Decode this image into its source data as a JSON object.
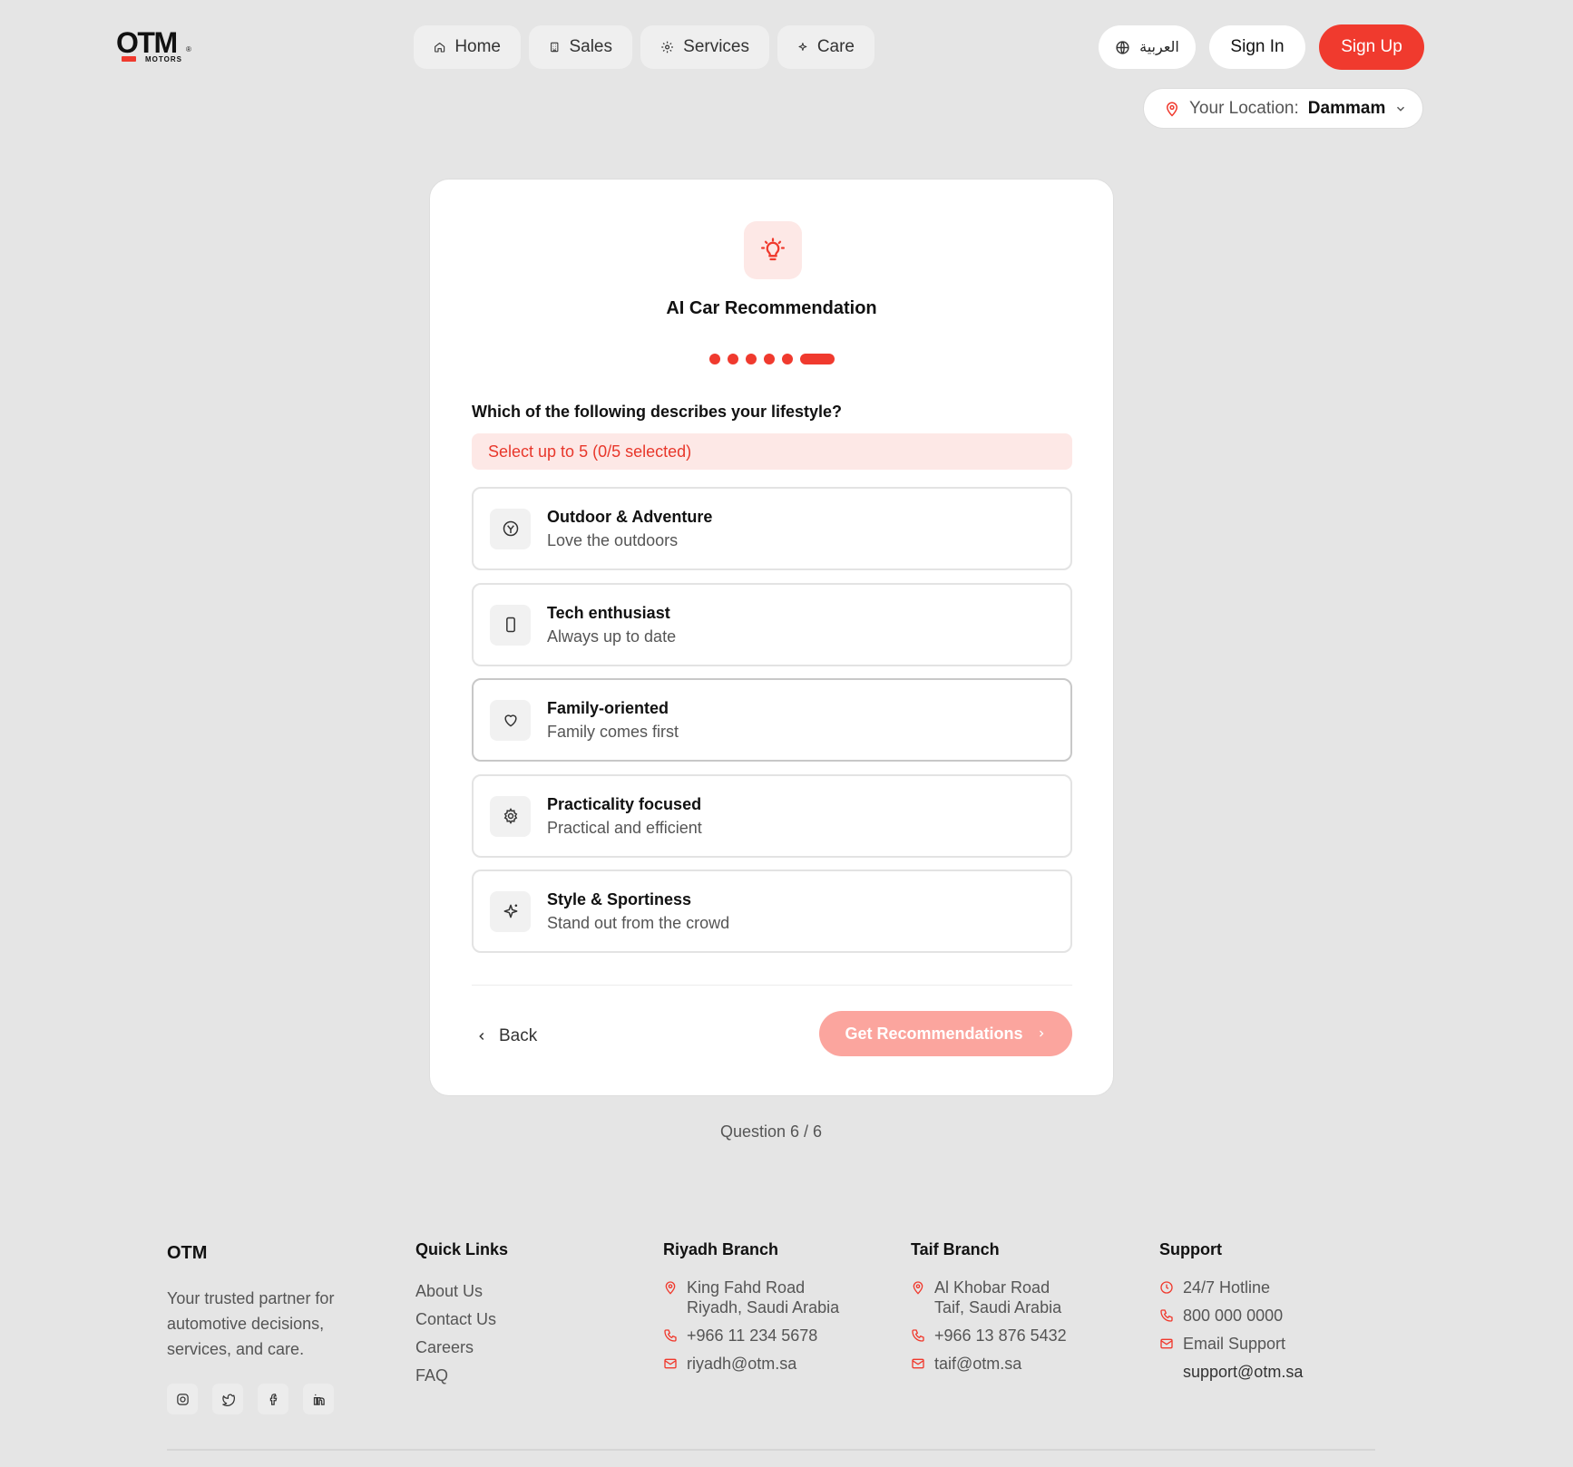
{
  "brand": {
    "name": "OTM",
    "sub": "MOTORS",
    "reg": "®"
  },
  "nav": [
    {
      "label": "Home",
      "icon": "home-icon"
    },
    {
      "label": "Sales",
      "icon": "building-icon"
    },
    {
      "label": "Services",
      "icon": "gear-icon"
    },
    {
      "label": "Care",
      "icon": "sparkle-icon"
    }
  ],
  "header": {
    "language": "العربية",
    "signin": "Sign In",
    "signup": "Sign Up",
    "location_label": "Your Location:",
    "location_value": "Dammam"
  },
  "wizard": {
    "title": "AI Car Recommendation",
    "step_count": 6,
    "current_step": 6,
    "question": "Which of the following describes your lifestyle?",
    "hint": "Select up to 5 (0/5 selected)",
    "options": [
      {
        "title": "Outdoor & Adventure",
        "subtitle": "Love the outdoors",
        "icon": "compass-icon"
      },
      {
        "title": "Tech enthusiast",
        "subtitle": "Always up to date",
        "icon": "phone-icon"
      },
      {
        "title": "Family-oriented",
        "subtitle": "Family comes first",
        "icon": "heart-icon"
      },
      {
        "title": "Practicality focused",
        "subtitle": "Practical and efficient",
        "icon": "gear-icon"
      },
      {
        "title": "Style & Sportiness",
        "subtitle": "Stand out from the crowd",
        "icon": "sparkle-icon"
      }
    ],
    "back_label": "Back",
    "submit_label": "Get Recommendations",
    "progress_text": "Question 6 / 6"
  },
  "footer": {
    "brand": "OTM",
    "description": "Your trusted partner for automotive decisions, services, and care.",
    "socials": [
      "instagram-icon",
      "twitter-icon",
      "facebook-icon",
      "linkedin-icon"
    ],
    "quick_links": {
      "heading": "Quick Links",
      "items": [
        "About Us",
        "Contact Us",
        "Careers",
        "FAQ"
      ]
    },
    "riyadh": {
      "heading": "Riyadh Branch",
      "address_line1": "King Fahd Road",
      "address_line2": "Riyadh, Saudi Arabia",
      "phone": "+966 11 234 5678",
      "email": "riyadh@otm.sa"
    },
    "taif": {
      "heading": "Taif Branch",
      "address_line1": "Al Khobar Road",
      "address_line2": "Taif, Saudi Arabia",
      "phone": "+966 13 876 5432",
      "email": "taif@otm.sa"
    },
    "support": {
      "heading": "Support",
      "hotline_label": "24/7 Hotline",
      "phone": "800 000 0000",
      "email_label": "Email Support",
      "email": "support@otm.sa"
    }
  },
  "colors": {
    "accent": "#f03a2e",
    "accent_soft": "#fde8e6",
    "button_disabled": "#fba59e",
    "background": "#e5e5e5"
  }
}
